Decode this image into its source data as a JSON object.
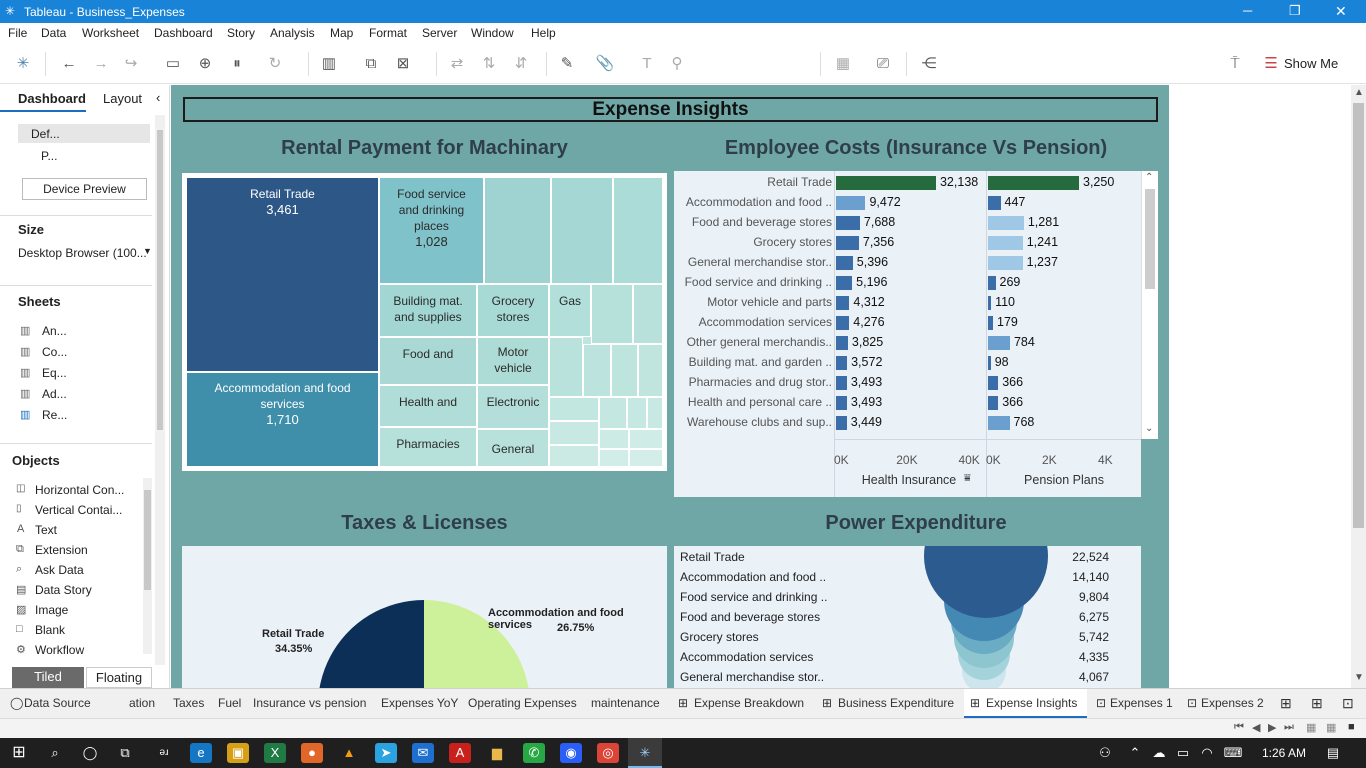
{
  "window": {
    "title": "Tableau - Business_Expenses",
    "minimize": "─",
    "restore": "❐",
    "close": "✕"
  },
  "menu": [
    "File",
    "Data",
    "Worksheet",
    "Dashboard",
    "Story",
    "Analysis",
    "Map",
    "Format",
    "Server",
    "Window",
    "Help"
  ],
  "toolbar": {
    "show_me": "Show Me"
  },
  "left": {
    "tab_dashboard": "Dashboard",
    "tab_layout": "Layout",
    "device_default": "Def...",
    "device_phone": "P...",
    "device_preview": "Device Preview",
    "size_heading": "Size",
    "size_value": "Desktop Browser (100...",
    "sheets_heading": "Sheets",
    "sheets": [
      "An...",
      "Co...",
      "Eq...",
      "Ad...",
      "Re..."
    ],
    "objects_heading": "Objects",
    "objects": [
      "Horizontal Con...",
      "Vertical Contai...",
      "Text",
      "Extension",
      "Ask Data",
      "Data Story",
      "Image",
      "Blank",
      "Workflow"
    ],
    "tiled": "Tiled",
    "floating": "Floating"
  },
  "dashboard": {
    "title": "Expense Insights",
    "treemap_title": "Rental Payment for Machinary",
    "employee_title": "Employee Costs (Insurance Vs Pension)",
    "taxes_title": "Taxes & Licenses",
    "power_title": "Power Expenditure"
  },
  "treemap": {
    "cells": [
      {
        "label": "Retail Trade",
        "value": "3,461"
      },
      {
        "label": "Accommodation and food services",
        "value": "1,710"
      },
      {
        "label": "Food service and drinking places",
        "value": "1,028"
      },
      {
        "label": "Building mat. and supplies",
        "value": ""
      },
      {
        "label": "Grocery stores",
        "value": ""
      },
      {
        "label": "Gas",
        "value": ""
      },
      {
        "label": "Food and",
        "value": ""
      },
      {
        "label": "Motor vehicle",
        "value": ""
      },
      {
        "label": "Health and",
        "value": ""
      },
      {
        "label": "Electronic",
        "value": ""
      },
      {
        "label": "Pharmacies",
        "value": ""
      },
      {
        "label": "General",
        "value": ""
      }
    ]
  },
  "chart_data": [
    {
      "type": "bar",
      "title": "Employee Costs (Insurance Vs Pension)",
      "categories": [
        "Retail Trade",
        "Accommodation and food ..",
        "Food and beverage stores",
        "Grocery stores",
        "General merchandise stor..",
        "Food service and drinking ..",
        "Motor vehicle and parts",
        "Accommodation services",
        "Other general merchandis..",
        "Building mat. and garden ..",
        "Pharmacies and drug stor..",
        "Health and personal care ..",
        "Warehouse clubs and sup.."
      ],
      "series": [
        {
          "name": "Health Insurance",
          "values": [
            32138,
            9472,
            7688,
            7356,
            5396,
            5196,
            4312,
            4276,
            3825,
            3572,
            3493,
            3493,
            3449
          ],
          "labels": [
            "32,138",
            "9,472",
            "7,688",
            "7,356",
            "5,396",
            "5,196",
            "4,312",
            "4,276",
            "3,825",
            "3,572",
            "3,493",
            "3,493",
            "3,449"
          ],
          "xlim": [
            0,
            45000
          ],
          "ticks": [
            "0K",
            "20K",
            "40K"
          ]
        },
        {
          "name": "Pension Plans",
          "values": [
            3250,
            447,
            1281,
            1241,
            1237,
            269,
            110,
            179,
            784,
            98,
            366,
            366,
            768
          ],
          "labels": [
            "3,250",
            "447",
            "1,281",
            "1,241",
            "1,237",
            "269",
            "110",
            "179",
            "784",
            "98",
            "366",
            "366",
            "768"
          ],
          "xlim": [
            0,
            5000
          ],
          "ticks": [
            "0K",
            "2K",
            "4K"
          ]
        }
      ],
      "colors": {
        "top": "#266b3d",
        "dark": "#3b6ea8",
        "mid": "#6a9fd0",
        "light": "#9fc8e6"
      }
    },
    {
      "type": "pie",
      "title": "Taxes & Licenses",
      "slices": [
        {
          "label": "Retail Trade",
          "percent": "34.35%",
          "value": 34.35,
          "color": "#0b2f56"
        },
        {
          "label": "Accommodation and food services",
          "percent": "26.75%",
          "value": 26.75,
          "color": "#cdf09a"
        }
      ]
    },
    {
      "type": "table",
      "title": "Power Expenditure",
      "categories": [
        "Retail Trade",
        "Accommodation and food ..",
        "Food service and drinking ..",
        "Food and beverage stores",
        "Grocery stores",
        "Accommodation services",
        "General merchandise stor.."
      ],
      "values": [
        22524,
        14140,
        9804,
        6275,
        5742,
        4335,
        4067
      ],
      "labels": [
        "22,524",
        "14,140",
        "9,804",
        "6,275",
        "5,742",
        "4,335",
        "4,067"
      ]
    }
  ],
  "tabs": [
    "Data Source",
    "ation",
    "Taxes",
    "Fuel",
    "Insurance vs pension",
    "Expenses YoY",
    "Operating Expenses",
    "maintenance",
    "Expense Breakdown",
    "Business Expenditure",
    "Expense Insights",
    "Expenses 1",
    "Expenses 2"
  ],
  "taskbar": {
    "time": "1:26 AM"
  }
}
